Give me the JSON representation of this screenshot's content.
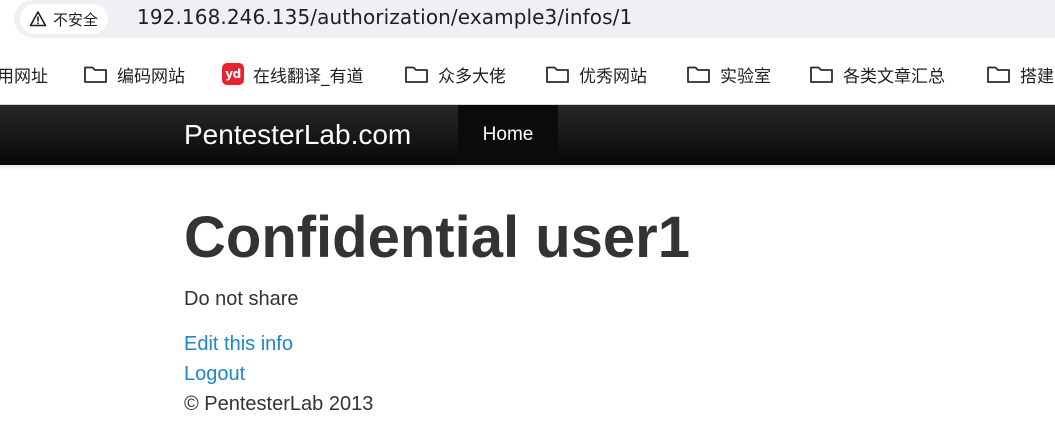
{
  "browser": {
    "security_label": "不安全",
    "url": "192.168.246.135/authorization/example3/infos/1",
    "security_icon": "warning-triangle-icon"
  },
  "bookmarks": [
    {
      "label": "用网址",
      "icon": "none"
    },
    {
      "label": "编码网站",
      "icon": "folder-icon"
    },
    {
      "label": "在线翻译_有道",
      "icon": "youdao-icon"
    },
    {
      "label": "众多大佬",
      "icon": "folder-icon"
    },
    {
      "label": "优秀网站",
      "icon": "folder-icon"
    },
    {
      "label": "实验室",
      "icon": "folder-icon"
    },
    {
      "label": "各类文章汇总",
      "icon": "folder-icon"
    },
    {
      "label": "搭建",
      "icon": "folder-icon"
    }
  ],
  "youdao_icon_text": "yd",
  "navbar": {
    "brand": "PentesterLab.com",
    "home": "Home"
  },
  "content": {
    "heading": "Confidential user1",
    "note": "Do not share",
    "edit_link": "Edit this info",
    "logout_link": "Logout",
    "footer": "© PentesterLab 2013"
  },
  "colors": {
    "navbar": "#111111",
    "link": "#1e86c7",
    "text": "#333333",
    "address_bar": "#eef0f6"
  }
}
